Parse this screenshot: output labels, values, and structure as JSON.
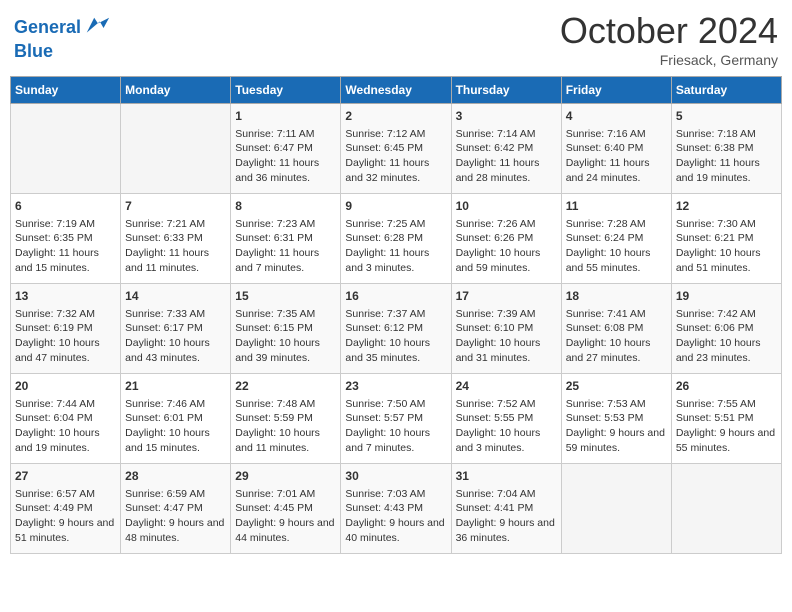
{
  "logo": {
    "line1": "General",
    "line2": "Blue"
  },
  "title": "October 2024",
  "subtitle": "Friesack, Germany",
  "days_of_week": [
    "Sunday",
    "Monday",
    "Tuesday",
    "Wednesday",
    "Thursday",
    "Friday",
    "Saturday"
  ],
  "weeks": [
    [
      {
        "day": "",
        "info": ""
      },
      {
        "day": "",
        "info": ""
      },
      {
        "day": "1",
        "info": "Sunrise: 7:11 AM\nSunset: 6:47 PM\nDaylight: 11 hours and 36 minutes."
      },
      {
        "day": "2",
        "info": "Sunrise: 7:12 AM\nSunset: 6:45 PM\nDaylight: 11 hours and 32 minutes."
      },
      {
        "day": "3",
        "info": "Sunrise: 7:14 AM\nSunset: 6:42 PM\nDaylight: 11 hours and 28 minutes."
      },
      {
        "day": "4",
        "info": "Sunrise: 7:16 AM\nSunset: 6:40 PM\nDaylight: 11 hours and 24 minutes."
      },
      {
        "day": "5",
        "info": "Sunrise: 7:18 AM\nSunset: 6:38 PM\nDaylight: 11 hours and 19 minutes."
      }
    ],
    [
      {
        "day": "6",
        "info": "Sunrise: 7:19 AM\nSunset: 6:35 PM\nDaylight: 11 hours and 15 minutes."
      },
      {
        "day": "7",
        "info": "Sunrise: 7:21 AM\nSunset: 6:33 PM\nDaylight: 11 hours and 11 minutes."
      },
      {
        "day": "8",
        "info": "Sunrise: 7:23 AM\nSunset: 6:31 PM\nDaylight: 11 hours and 7 minutes."
      },
      {
        "day": "9",
        "info": "Sunrise: 7:25 AM\nSunset: 6:28 PM\nDaylight: 11 hours and 3 minutes."
      },
      {
        "day": "10",
        "info": "Sunrise: 7:26 AM\nSunset: 6:26 PM\nDaylight: 10 hours and 59 minutes."
      },
      {
        "day": "11",
        "info": "Sunrise: 7:28 AM\nSunset: 6:24 PM\nDaylight: 10 hours and 55 minutes."
      },
      {
        "day": "12",
        "info": "Sunrise: 7:30 AM\nSunset: 6:21 PM\nDaylight: 10 hours and 51 minutes."
      }
    ],
    [
      {
        "day": "13",
        "info": "Sunrise: 7:32 AM\nSunset: 6:19 PM\nDaylight: 10 hours and 47 minutes."
      },
      {
        "day": "14",
        "info": "Sunrise: 7:33 AM\nSunset: 6:17 PM\nDaylight: 10 hours and 43 minutes."
      },
      {
        "day": "15",
        "info": "Sunrise: 7:35 AM\nSunset: 6:15 PM\nDaylight: 10 hours and 39 minutes."
      },
      {
        "day": "16",
        "info": "Sunrise: 7:37 AM\nSunset: 6:12 PM\nDaylight: 10 hours and 35 minutes."
      },
      {
        "day": "17",
        "info": "Sunrise: 7:39 AM\nSunset: 6:10 PM\nDaylight: 10 hours and 31 minutes."
      },
      {
        "day": "18",
        "info": "Sunrise: 7:41 AM\nSunset: 6:08 PM\nDaylight: 10 hours and 27 minutes."
      },
      {
        "day": "19",
        "info": "Sunrise: 7:42 AM\nSunset: 6:06 PM\nDaylight: 10 hours and 23 minutes."
      }
    ],
    [
      {
        "day": "20",
        "info": "Sunrise: 7:44 AM\nSunset: 6:04 PM\nDaylight: 10 hours and 19 minutes."
      },
      {
        "day": "21",
        "info": "Sunrise: 7:46 AM\nSunset: 6:01 PM\nDaylight: 10 hours and 15 minutes."
      },
      {
        "day": "22",
        "info": "Sunrise: 7:48 AM\nSunset: 5:59 PM\nDaylight: 10 hours and 11 minutes."
      },
      {
        "day": "23",
        "info": "Sunrise: 7:50 AM\nSunset: 5:57 PM\nDaylight: 10 hours and 7 minutes."
      },
      {
        "day": "24",
        "info": "Sunrise: 7:52 AM\nSunset: 5:55 PM\nDaylight: 10 hours and 3 minutes."
      },
      {
        "day": "25",
        "info": "Sunrise: 7:53 AM\nSunset: 5:53 PM\nDaylight: 9 hours and 59 minutes."
      },
      {
        "day": "26",
        "info": "Sunrise: 7:55 AM\nSunset: 5:51 PM\nDaylight: 9 hours and 55 minutes."
      }
    ],
    [
      {
        "day": "27",
        "info": "Sunrise: 6:57 AM\nSunset: 4:49 PM\nDaylight: 9 hours and 51 minutes."
      },
      {
        "day": "28",
        "info": "Sunrise: 6:59 AM\nSunset: 4:47 PM\nDaylight: 9 hours and 48 minutes."
      },
      {
        "day": "29",
        "info": "Sunrise: 7:01 AM\nSunset: 4:45 PM\nDaylight: 9 hours and 44 minutes."
      },
      {
        "day": "30",
        "info": "Sunrise: 7:03 AM\nSunset: 4:43 PM\nDaylight: 9 hours and 40 minutes."
      },
      {
        "day": "31",
        "info": "Sunrise: 7:04 AM\nSunset: 4:41 PM\nDaylight: 9 hours and 36 minutes."
      },
      {
        "day": "",
        "info": ""
      },
      {
        "day": "",
        "info": ""
      }
    ]
  ]
}
